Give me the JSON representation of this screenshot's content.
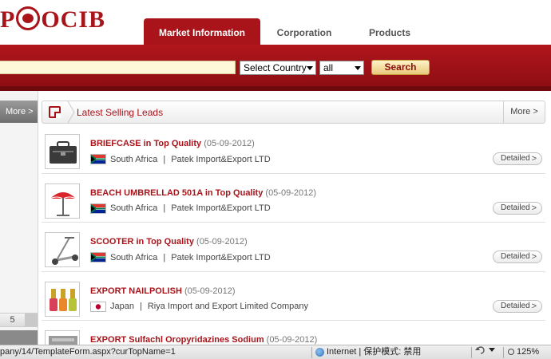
{
  "header": {
    "logo_text": "OCIB",
    "tabs": [
      {
        "label": "Market Information",
        "active": true
      },
      {
        "label": "Corporation",
        "active": false
      },
      {
        "label": "Products",
        "active": false
      }
    ]
  },
  "search": {
    "keyword_value": "",
    "country_select": "Select Country",
    "category_select": "all",
    "button_label": "Search"
  },
  "sidebar": {
    "more_label": "More",
    "page_number": "5"
  },
  "panel": {
    "title": "Latest Selling Leads",
    "more_label": "More",
    "items": [
      {
        "title": "BRIEFCASE in Top Quality",
        "date": "(05-09-2012)",
        "country": "South Africa",
        "company": "Patek Import&Export LTD",
        "detail": "Detailed",
        "flag": "south-africa-flag-icon",
        "thumb": "briefcase-image"
      },
      {
        "title": "BEACH UMBRELLAD 501A in Top Quality",
        "date": "(05-09-2012)",
        "country": "South Africa",
        "company": "Patek Import&Export LTD",
        "detail": "Detailed",
        "flag": "south-africa-flag-icon",
        "thumb": "umbrella-image"
      },
      {
        "title": "SCOOTER in Top Quality",
        "date": "(05-09-2012)",
        "country": "South Africa",
        "company": "Patek Import&Export LTD",
        "detail": "Detailed",
        "flag": "south-africa-flag-icon",
        "thumb": "scooter-image"
      },
      {
        "title": "EXPORT NAILPOLISH",
        "date": "(05-09-2012)",
        "country": "Japan",
        "company": "Riya Import and Export Limited Company",
        "detail": "Detailed",
        "flag": "japan-flag-icon",
        "thumb": "nailpolish-image"
      },
      {
        "title": "EXPORT Sulfachl Oropyridazines Sodium",
        "date": "(05-09-2012)",
        "country": "",
        "company": "",
        "detail": "",
        "flag": "",
        "thumb": "chemical-image"
      }
    ]
  },
  "statusbar": {
    "url": "pany/14/TemplateForm.aspx?curTopName=1",
    "zone": "Internet | 保护模式: 禁用",
    "zoom": "125%"
  },
  "colors": {
    "brand_red": "#a8141a",
    "search_button": "#e8c97b"
  }
}
